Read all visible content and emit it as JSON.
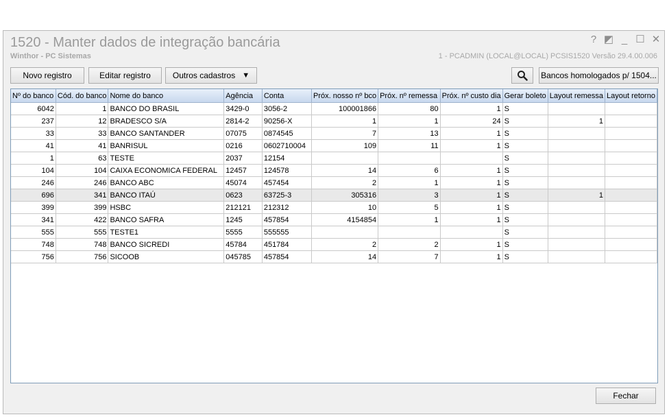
{
  "window": {
    "title": "1520 - Manter dados de integração bancária",
    "subtitle": "Winthor - PC Sistemas",
    "user_info": "1 - PCADMIN (LOCAL@LOCAL)   PCSIS1520  Versão  29.4.00.006",
    "controls": {
      "help": "?",
      "restore": "◩",
      "minimize": "_",
      "maximize": "☐",
      "close": "✕"
    }
  },
  "toolbar": {
    "novo": "Novo registro",
    "editar": "Editar registro",
    "outros": "Outros cadastros",
    "outros_arrow": "▼",
    "bancos_homologados": "Bancos homologados p/ 1504..."
  },
  "grid": {
    "columns": [
      "Nº do banco",
      "Cód. do banco",
      "Nome do banco",
      "Agência",
      "Conta",
      "Próx. nosso nº bco",
      "Próx. nº remessa",
      "Próx. nº custo dia",
      "Gerar boleto",
      "Layout remessa",
      "Layout retorno"
    ],
    "rows": [
      [
        "6042",
        "1",
        "BANCO DO BRASIL",
        "3429-0",
        "3056-2",
        "100001866",
        "80",
        "1",
        "S",
        "",
        ""
      ],
      [
        "237",
        "12",
        "BRADESCO S/A",
        "2814-2",
        "90256-X",
        "1",
        "1",
        "24",
        "S",
        "1",
        ""
      ],
      [
        "33",
        "33",
        "BANCO SANTANDER",
        "07075",
        "0874545",
        "7",
        "13",
        "1",
        "S",
        "",
        ""
      ],
      [
        "41",
        "41",
        "BANRISUL",
        "0216",
        "0602710004",
        "109",
        "11",
        "1",
        "S",
        "",
        ""
      ],
      [
        "1",
        "63",
        "TESTE",
        "2037",
        "12154",
        "",
        "",
        "",
        "S",
        "",
        ""
      ],
      [
        "104",
        "104",
        "CAIXA ECONOMICA FEDERAL",
        "12457",
        "124578",
        "14",
        "6",
        "1",
        "S",
        "",
        ""
      ],
      [
        "246",
        "246",
        "BANCO ABC",
        "45074",
        "457454",
        "2",
        "1",
        "1",
        "S",
        "",
        ""
      ],
      [
        "696",
        "341",
        "BANCO ITAÚ",
        "0623",
        "63725-3",
        "305316",
        "3",
        "1",
        "S",
        "1",
        ""
      ],
      [
        "399",
        "399",
        "HSBC",
        "212121",
        "212312",
        "10",
        "5",
        "1",
        "S",
        "",
        ""
      ],
      [
        "341",
        "422",
        "BANCO SAFRA",
        "1245",
        "457854",
        "4154854",
        "1",
        "1",
        "S",
        "",
        ""
      ],
      [
        "555",
        "555",
        "TESTE1",
        "5555",
        "555555",
        "",
        "",
        "",
        "S",
        "",
        ""
      ],
      [
        "748",
        "748",
        "BANCO SICREDI",
        "45784",
        "451784",
        "2",
        "2",
        "1",
        "S",
        "",
        ""
      ],
      [
        "756",
        "756",
        "SICOOB",
        "045785",
        "457854",
        "14",
        "7",
        "1",
        "S",
        "",
        ""
      ]
    ],
    "selected_row": 7
  },
  "footer": {
    "fechar": "Fechar"
  }
}
